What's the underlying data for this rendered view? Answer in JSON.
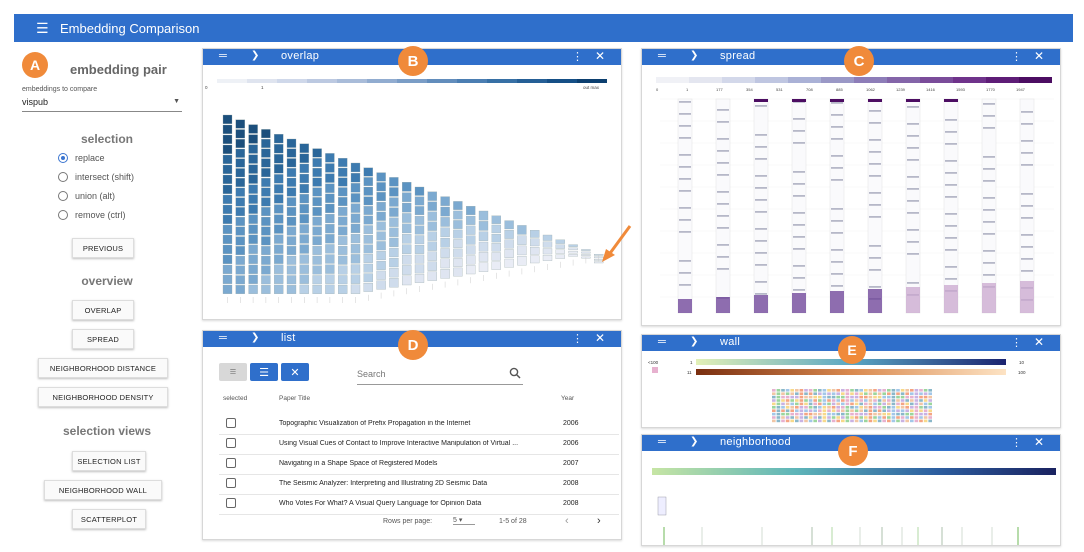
{
  "app": {
    "title": "Embedding Comparison"
  },
  "sidebar": {
    "badge": "A",
    "pair_title": "embedding pair",
    "compare_label": "embeddings to compare",
    "compare_value": "vispub",
    "selection_title": "selection",
    "radios": [
      {
        "label": "replace",
        "checked": true
      },
      {
        "label": "intersect (shift)"
      },
      {
        "label": "union (alt)"
      },
      {
        "label": "remove (ctrl)"
      }
    ],
    "previous": "Previous",
    "overview_title": "overview",
    "overview_buttons": [
      "Overlap",
      "Spread",
      "Neighborhood Distance",
      "Neighborhood Density"
    ],
    "views_title": "selection views",
    "view_buttons": [
      "Selection List",
      "Neighborhood Wall",
      "Scatterplot"
    ]
  },
  "panels": {
    "overlap": {
      "name": "overlap",
      "badge": "B",
      "legend_left": [
        "0",
        "1"
      ],
      "legend_right": "out max"
    },
    "spread": {
      "name": "spread",
      "badge": "C",
      "legend": [
        "0",
        "1",
        "177",
        "354",
        "531",
        "708",
        "885",
        "1062",
        "1239",
        "1416",
        "1593",
        "1770",
        "1947"
      ]
    },
    "list": {
      "name": "list",
      "badge": "D",
      "search_placeholder": "Search",
      "col_selected": "selected",
      "col_title": "Paper Title",
      "col_year": "Year",
      "rows": [
        {
          "title": "Topographic Visualization of Prefix Propagation in the Internet",
          "year": "2006"
        },
        {
          "title": "Using Visual Cues of Contact to Improve Interactive Manipulation of Virtual ...",
          "year": "2006"
        },
        {
          "title": "Navigating in a Shape Space of Registered Models",
          "year": "2007"
        },
        {
          "title": "The Seismic Analyzer: Interpreting and Illustrating 2D Seismic Data",
          "year": "2008"
        },
        {
          "title": "Who Votes For What? A Visual Query Language for Opinion Data",
          "year": "2008"
        }
      ],
      "rows_per_page_label": "Rows per page:",
      "rows_per_page": "5",
      "range": "1-5 of 28"
    },
    "wall": {
      "name": "wall",
      "badge": "E",
      "labels": [
        "1",
        "10",
        "11",
        "100",
        "<100"
      ]
    },
    "neighborhood": {
      "name": "neighborhood",
      "badge": "F"
    }
  },
  "colors": {
    "accent": "#2f6fcb",
    "badge": "#f08a3a",
    "arrow": "#f08a3a"
  }
}
